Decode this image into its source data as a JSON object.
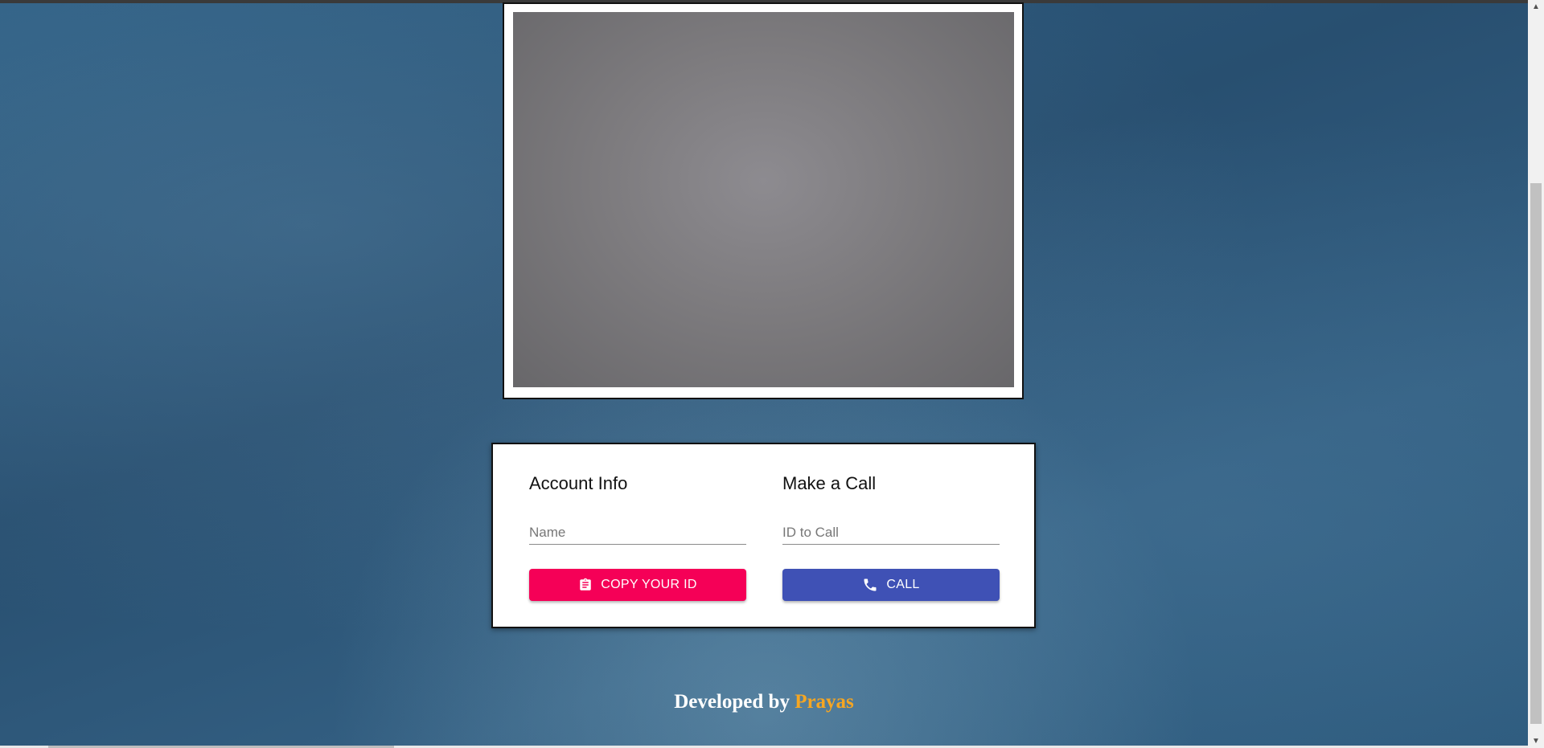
{
  "video": {
    "state": "camera-preview"
  },
  "account": {
    "title": "Account Info",
    "name_placeholder": "Name",
    "name_value": "",
    "copy_button_label": "COPY YOUR ID",
    "copy_icon": "clipboard-icon"
  },
  "call": {
    "title": "Make a Call",
    "id_placeholder": "ID to Call",
    "id_value": "",
    "call_button_label": "CALL",
    "call_icon": "phone-icon"
  },
  "footer": {
    "prefix": "Developed by",
    "author": "Prayas"
  },
  "colors": {
    "copy_button": "#f50057",
    "call_button": "#3f51b5",
    "author_name": "#f5a623",
    "background": "#2c587a"
  }
}
